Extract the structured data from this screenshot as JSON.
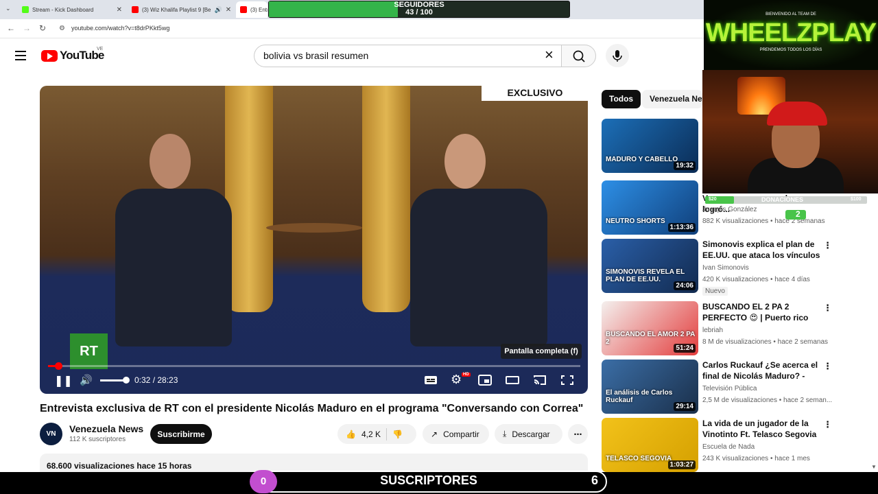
{
  "browser": {
    "tabs": [
      {
        "title": "Stream - Kick Dashboard",
        "favicon_color": "#53fc18"
      },
      {
        "title": "(3) Wiz Khalifa Playlist 9 [Be",
        "favicon_color": "#ff0000"
      },
      {
        "title": "(3) Entr",
        "favicon_color": "#ff0000"
      }
    ],
    "url": "youtube.com/watch?v=t8drPKkt5wg"
  },
  "header": {
    "logo_text": "YouTube",
    "country_code": "VE",
    "search_value": "bolivia vs brasil resumen"
  },
  "player": {
    "badge": "EXCLUSIVO",
    "channel_logo": "RT",
    "tooltip": "Pantalla completa (f)",
    "time": "0:32 / 28:23",
    "progress_fraction": 0.019,
    "volume_fraction": 0.85,
    "settings_badge": "HD"
  },
  "video": {
    "title": "Entrevista exclusiva de RT con el presidente Nicolás Maduro en el programa \"Conversando con Correa\"",
    "channel": "Venezuela News",
    "channel_initials": "VN",
    "subscribers": "112 K suscriptores",
    "subscribe_label": "Suscribirme",
    "likes": "4,2 K",
    "share_label": "Compartir",
    "download_label": "Descargar",
    "views_line": "68.600 visualizaciones  hace 15 horas"
  },
  "sidebar": {
    "chips": [
      "Todos",
      "Venezuela News"
    ],
    "items": [
      {
        "title": "",
        "channel": "",
        "meta": "",
        "duration": "19:32",
        "caption": "MADURO Y CABELLO",
        "color1": "#1c6fb8",
        "color2": "#0b2c55"
      },
      {
        "title": "Vxxxxxarme pero no lo logró...",
        "channel": "Juanpis González",
        "meta": "882 K visualizaciones • hace 2 semanas",
        "duration": "1:13:36",
        "caption": "NEUTRO SHORTS",
        "color1": "#2d8fe6",
        "color2": "#103f7a"
      },
      {
        "title": "Simonovis explica el plan de EE.UU. que ataca los vínculos ...",
        "channel": "Ivan Simonovis",
        "meta": "420 K visualizaciones • hace 4 días",
        "badge": "Nuevo",
        "duration": "24:06",
        "caption": "SIMONOVIS REVELA EL PLAN DE EE.UU.",
        "color1": "#2a5fa8",
        "color2": "#122a4f"
      },
      {
        "title": "BUSCANDO EL 2 PA 2 PERFECTO 😍 | Puerto rico",
        "channel": "lebriah",
        "meta": "8 M de visualizaciones • hace 2 semanas",
        "duration": "51:24",
        "caption": "BUSCANDO EL AMOR 2 PA 2",
        "color1": "#f4f0ee",
        "color2": "#e33c3c"
      },
      {
        "title": "Carlos Ruckauf ¿Se acerca el final de Nicolás Maduro? - Las...",
        "channel": "Televisión Pública",
        "meta": "2,5 M de visualizaciones • hace 2 seman...",
        "duration": "29:14",
        "caption": "El análisis de Carlos Ruckauf",
        "color1": "#3b6ea6",
        "color2": "#1a2f4a"
      },
      {
        "title": "La vida de un jugador de la Vinotinto Ft. Telasco Segovia",
        "channel": "Escuela de Nada",
        "meta": "243 K visualizaciones • hace 1 mes",
        "duration": "1:03:27",
        "caption": "TELASCO SEGOVIA",
        "color1": "#f2c21a",
        "color2": "#d5a000"
      }
    ]
  },
  "overlays": {
    "followers_label": "SEGUIDORES",
    "followers_count": "43 / 100",
    "followers_fraction": 0.43,
    "brand_top": "BIENVENIDO AL TEAM DE",
    "brand_name": "WHEELZPLAY",
    "brand_sub": "PRENDEMOS TODOS LOS DÍAS",
    "donate_min": "$20",
    "donate_goal": "DONACIONES",
    "donate_max": "$100",
    "donate_fraction": 0.18,
    "donate_count": "2",
    "subs_label": "SUSCRIPTORES",
    "subs_current": "0",
    "subs_goal": "6"
  }
}
